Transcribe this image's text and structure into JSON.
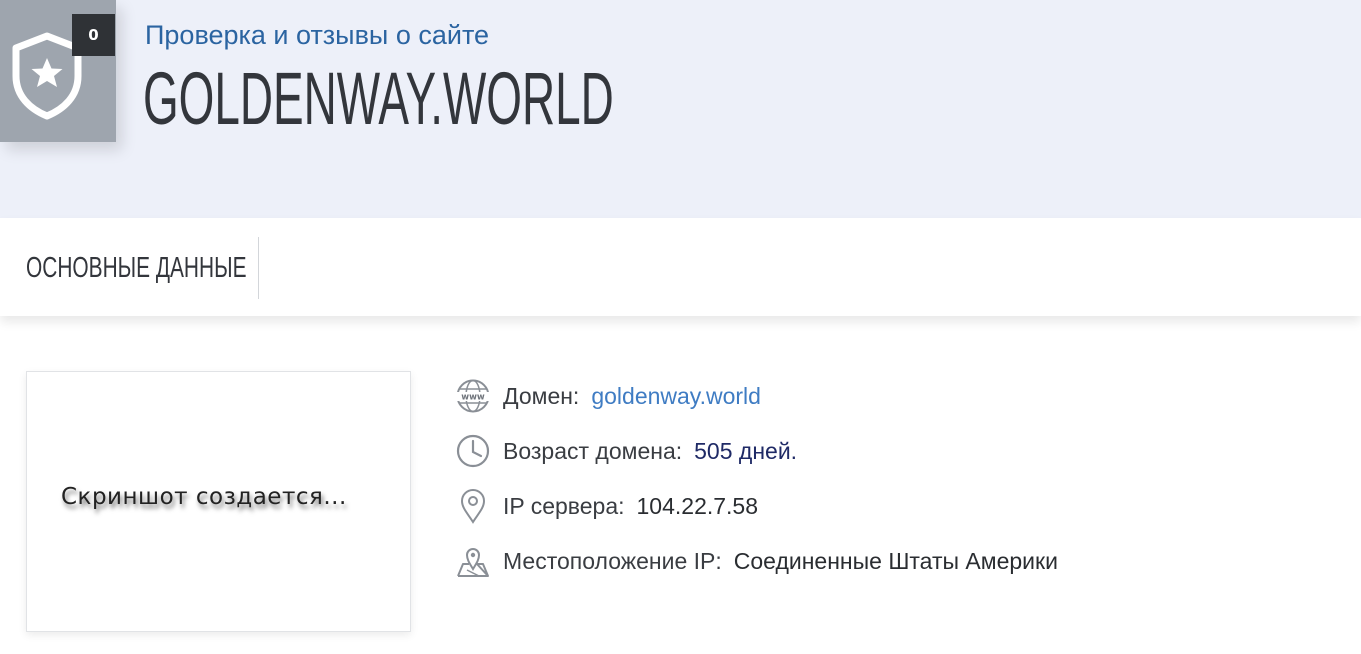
{
  "header": {
    "count": "0",
    "subtitle": "Проверка и отзывы о сайте",
    "title": "GOLDENWAY.WORLD"
  },
  "tabs": [
    {
      "label": "ОСНОВНЫЕ ДАННЫЕ"
    }
  ],
  "screenshot": {
    "placeholder": "Скриншот создается..."
  },
  "info": {
    "domain": {
      "label": "Домен:",
      "value": "goldenway.world",
      "icon": "www-globe-icon"
    },
    "age": {
      "label": "Возраст домена:",
      "value": "505 дней.",
      "icon": "clock-icon"
    },
    "ip": {
      "label": "IP сервера:",
      "value": "104.22.7.58",
      "icon": "map-pin-icon"
    },
    "location": {
      "label": "Местоположение IP:",
      "value": "Соединенные Штаты Америки",
      "icon": "map-location-icon"
    }
  },
  "colors": {
    "header_bg": "#edf0f9",
    "badge_bg": "#9ea5ae",
    "accent_blue": "#2b64a1",
    "link_blue": "#3f7cc3",
    "age_navy": "#1f2a66"
  }
}
